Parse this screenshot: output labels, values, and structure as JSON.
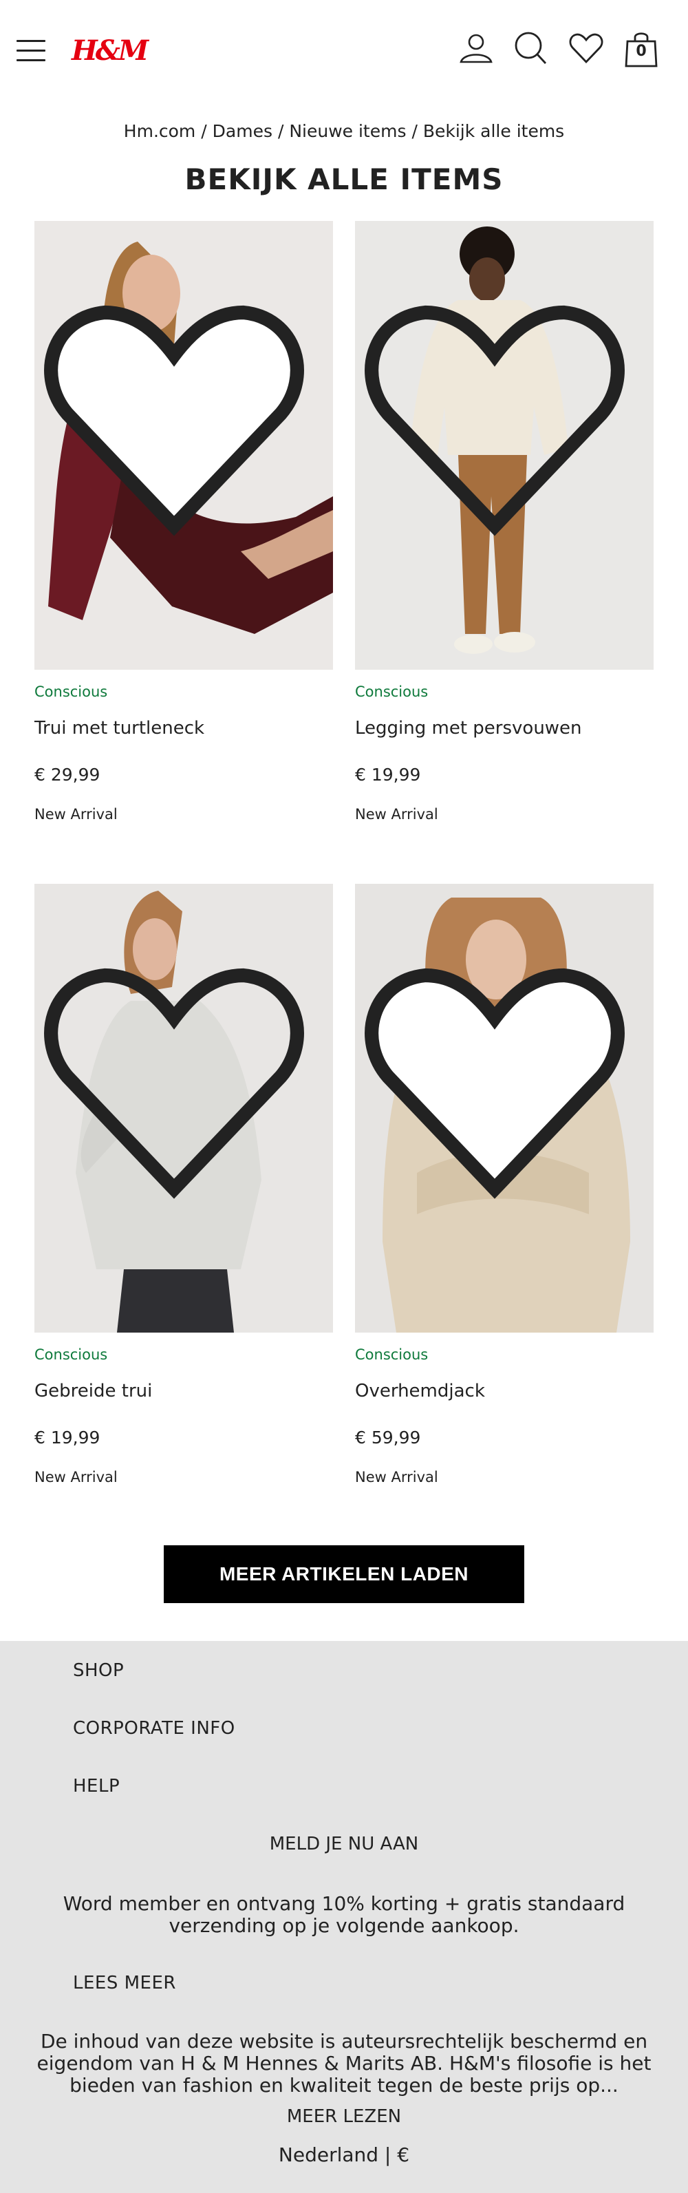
{
  "header": {
    "logo": "H&M",
    "cart_count": "0"
  },
  "breadcrumb": {
    "items": [
      "Hm.com",
      "Dames",
      "Nieuwe items",
      "Bekijk alle items"
    ],
    "separator": "/"
  },
  "page_title": "BEKIJK ALLE ITEMS",
  "products": [
    {
      "tag": "Conscious",
      "name": "Trui met turtleneck",
      "price": "€ 29,99",
      "badge": "New Arrival"
    },
    {
      "tag": "Conscious",
      "name": "Legging met persvouwen",
      "price": "€ 19,99",
      "badge": "New Arrival"
    },
    {
      "tag": "Conscious",
      "name": "Gebreide trui",
      "price": "€ 19,99",
      "badge": "New Arrival"
    },
    {
      "tag": "Conscious",
      "name": "Overhemdjack",
      "price": "€ 59,99",
      "badge": "New Arrival"
    }
  ],
  "load_more_label": "MEER ARTIKELEN LADEN",
  "footer": {
    "links": [
      "SHOP",
      "CORPORATE INFO",
      "HELP"
    ],
    "signup": "MELD JE NU AAN",
    "member_text": "Word member en ontvang 10% korting + gratis standaard verzending op je volgende aankoop.",
    "read_more": "LEES MEER",
    "copyright": "De inhoud van deze website is auteursrechtelijk beschermd en eigendom van H & M Hennes & Marits AB. H&M's filosofie is het bieden van fashion en kwaliteit tegen de beste prijs op...",
    "read_more_2": "MEER LEZEN",
    "locale": "Nederland | €"
  },
  "colors": {
    "brand": "#e50010",
    "conscious": "#0f7a3c",
    "footer_bg": "#e4e4e4",
    "button_bg": "#000000"
  },
  "icons": [
    "menu-icon",
    "account-icon",
    "search-icon",
    "heart-icon",
    "bag-icon"
  ]
}
